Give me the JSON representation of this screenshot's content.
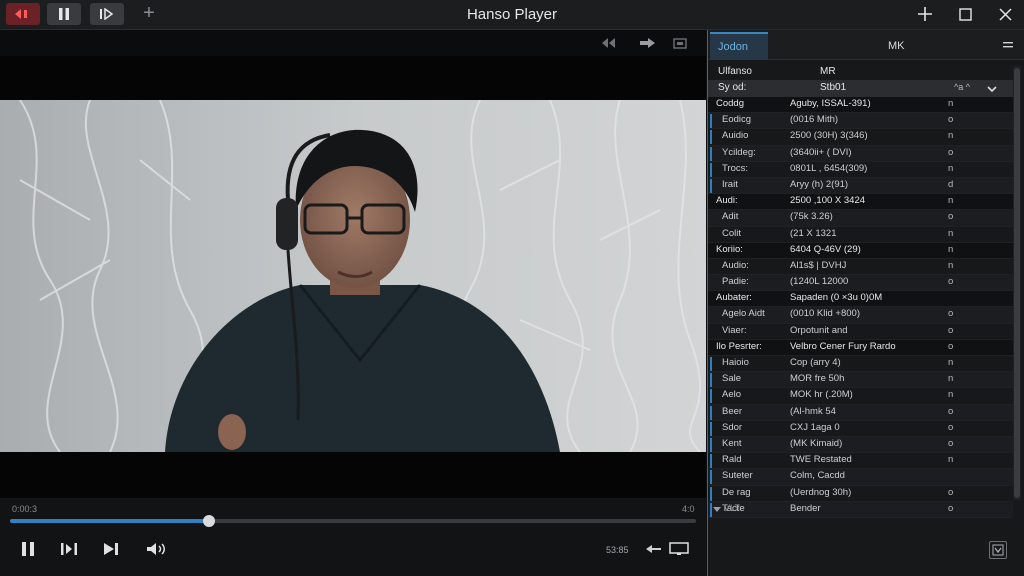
{
  "app_title": "Hanso Player",
  "colors": {
    "accent": "#2f7fc2",
    "record_red": "#ff5c5c",
    "panel_bg": "#16181a"
  },
  "titlebar": {
    "left_buttons": [
      "record-icon",
      "pause-icon",
      "frame-step-icon"
    ],
    "new_tab_icon": "plus-icon",
    "window_controls": [
      "plus-icon",
      "maximize-icon",
      "close-icon"
    ]
  },
  "video": {
    "strip_icons": [
      "rewind-icon",
      "forward-icon",
      "screen-icon"
    ]
  },
  "playback": {
    "time_elapsed": "0:00:3",
    "time_total": "4:0",
    "progress": 0.29,
    "speed_label": "53:85"
  },
  "panel": {
    "tab_active": "Jodon",
    "tab_other": "MK",
    "header": {
      "key": "Ulfanso",
      "value": "MR"
    },
    "selected": {
      "key": "Sy od:",
      "value": "Stb01",
      "mid": "^a ^"
    },
    "rows": [
      {
        "key": "Coddg",
        "value": "Aguby, ISSAL-391)",
        "flag": "n",
        "type": "hdr"
      },
      {
        "key": "Eodicg",
        "value": "(0016 Mith)",
        "flag": "o",
        "type": "sub",
        "bar": true
      },
      {
        "key": "Auidio",
        "value": "2500 (30H) 3(346)",
        "flag": "n",
        "type": "sub",
        "bar": true
      },
      {
        "key": "Ycildeg:",
        "value": "(3640ii+ ( DVI)",
        "flag": "o",
        "type": "sub",
        "bar": true
      },
      {
        "key": "Trocs:",
        "value": "0801L , 6454(309)",
        "flag": "n",
        "type": "sub",
        "bar": true
      },
      {
        "key": "Irait",
        "value": "Aryy (h) 2(91)",
        "flag": "d",
        "type": "sub",
        "bar": true
      },
      {
        "key": "Audi:",
        "value": "2500 ,100 X 3424",
        "flag": "n",
        "type": "hdr"
      },
      {
        "key": "Adit",
        "value": "(75k 3.26)",
        "flag": "o",
        "type": "sub"
      },
      {
        "key": "Colit",
        "value": "(21 X 1321",
        "flag": "n",
        "type": "sub"
      },
      {
        "key": "Koriio:",
        "value": "6404 Q-46V (29)",
        "flag": "n",
        "type": "hdr"
      },
      {
        "key": "Audio:",
        "value": "Al1s$ | DVHJ",
        "flag": "n",
        "type": "sub"
      },
      {
        "key": "Padie:",
        "value": "(1240L 12000",
        "flag": "o",
        "type": "sub"
      },
      {
        "key": "Aubater:",
        "value": "Sapaden (0 ×3u 0)0M",
        "flag": "",
        "type": "hdr"
      },
      {
        "key": "Agelo Aidt",
        "value": "(0010 Klid +800)",
        "flag": "o",
        "type": "sub"
      },
      {
        "key": "Viaer:",
        "value": "Orpotunit and",
        "flag": "o",
        "type": "sub"
      },
      {
        "key": "Ilo Pesrter:",
        "value": "Velbro Cener Fury Rardo",
        "flag": "o",
        "type": "hdr"
      },
      {
        "key": "Haioio",
        "value": "Cop (arry 4)",
        "flag": "n",
        "type": "sub",
        "bar": true
      },
      {
        "key": "Sale",
        "value": "MOR fre 50h",
        "flag": "n",
        "type": "sub",
        "bar": true
      },
      {
        "key": "Aelo",
        "value": "MOK hr (.20M)",
        "flag": "n",
        "type": "sub",
        "bar": true
      },
      {
        "key": "Beer",
        "value": "(Al-hmk 54",
        "flag": "o",
        "type": "sub",
        "bar": true
      },
      {
        "key": "Sdor",
        "value": "CXJ 1aga 0",
        "flag": "o",
        "type": "sub",
        "bar": true
      },
      {
        "key": "Kent",
        "value": "(MK Kimaid)",
        "flag": "o",
        "type": "sub",
        "bar": true
      },
      {
        "key": "Rald",
        "value": "TWE Restated",
        "flag": "n",
        "type": "sub",
        "bar": true
      },
      {
        "key": "Suteter",
        "value": "Colm, Cacdd",
        "flag": "",
        "type": "sub",
        "bar": true
      },
      {
        "key": "De rag",
        "value": "(Uerdnog 30h)",
        "flag": "o",
        "type": "sub",
        "bar": true
      },
      {
        "key": "Tacte",
        "value": "Bender",
        "flag": "o",
        "type": "sub",
        "bar": true
      }
    ],
    "footer_label": "VLT",
    "corner_icon": "download-icon"
  }
}
